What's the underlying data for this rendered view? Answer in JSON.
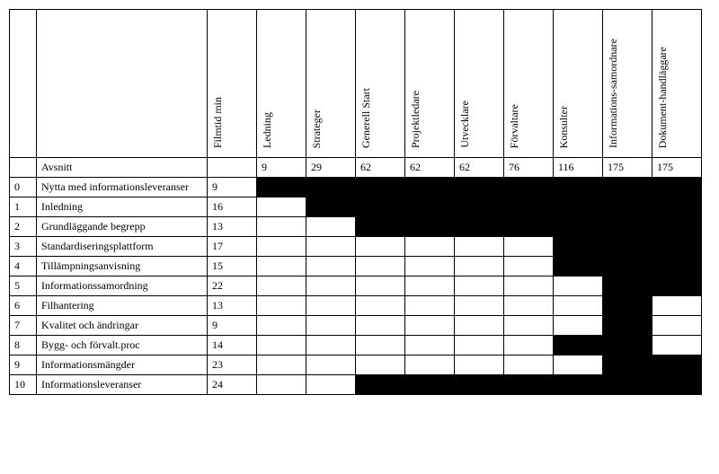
{
  "columns": [
    "Filmtid min",
    "Ledning",
    "Strateger",
    "Generell\nStart",
    "Projektledare",
    "Utvecklare",
    "Förvaltare",
    "Konsulter",
    "Informations-samordnare",
    "Dokument-handläggare"
  ],
  "section_label": "Avsnitt",
  "section_totals": [
    "",
    "9",
    "29",
    "62",
    "62",
    "62",
    "76",
    "116",
    "175",
    "175"
  ],
  "rows": [
    {
      "n": "0",
      "title": "Nytta med informationsleveranser",
      "v": [
        "9",
        "b",
        "b",
        "b",
        "b",
        "b",
        "b",
        "b",
        "b",
        "b"
      ]
    },
    {
      "n": "1",
      "title": "Inledning",
      "v": [
        "16",
        "",
        "b",
        "b",
        "b",
        "b",
        "b",
        "b",
        "b",
        "b"
      ]
    },
    {
      "n": "2",
      "title": "Grundläggande begrepp",
      "v": [
        "13",
        "",
        "",
        "b",
        "b",
        "b",
        "b",
        "b",
        "b",
        "b"
      ]
    },
    {
      "n": "3",
      "title": "Standardiseringsplattform",
      "v": [
        "17",
        "",
        "",
        "",
        "",
        "",
        "",
        "b",
        "b",
        "b"
      ]
    },
    {
      "n": "4",
      "title": "Tillämpningsanvisning",
      "v": [
        "15",
        "",
        "",
        "",
        "",
        "",
        "",
        "b",
        "b",
        "b"
      ]
    },
    {
      "n": "5",
      "title": "Informationssamordning",
      "v": [
        "22",
        "",
        "",
        "",
        "",
        "",
        "",
        "",
        "b",
        "b"
      ]
    },
    {
      "n": "6",
      "title": "Filhantering",
      "v": [
        "13",
        "",
        "",
        "",
        "",
        "",
        "",
        "",
        "b",
        ""
      ]
    },
    {
      "n": "7",
      "title": "Kvalitet och ändringar",
      "v": [
        "9",
        "",
        "",
        "",
        "",
        "",
        "",
        "",
        "b",
        ""
      ]
    },
    {
      "n": "8",
      "title": "Bygg- och förvalt.proc",
      "v": [
        "14",
        "",
        "",
        "",
        "",
        "",
        "",
        "b",
        "b",
        ""
      ]
    },
    {
      "n": "9",
      "title": "Informationsmängder",
      "v": [
        "23",
        "",
        "",
        "",
        "",
        "",
        "",
        "",
        "b",
        "b"
      ]
    },
    {
      "n": "10",
      "title": "Informationsleveranser",
      "v": [
        "24",
        "",
        "",
        "b",
        "b",
        "b",
        "b",
        "b",
        "b",
        "b"
      ]
    }
  ]
}
